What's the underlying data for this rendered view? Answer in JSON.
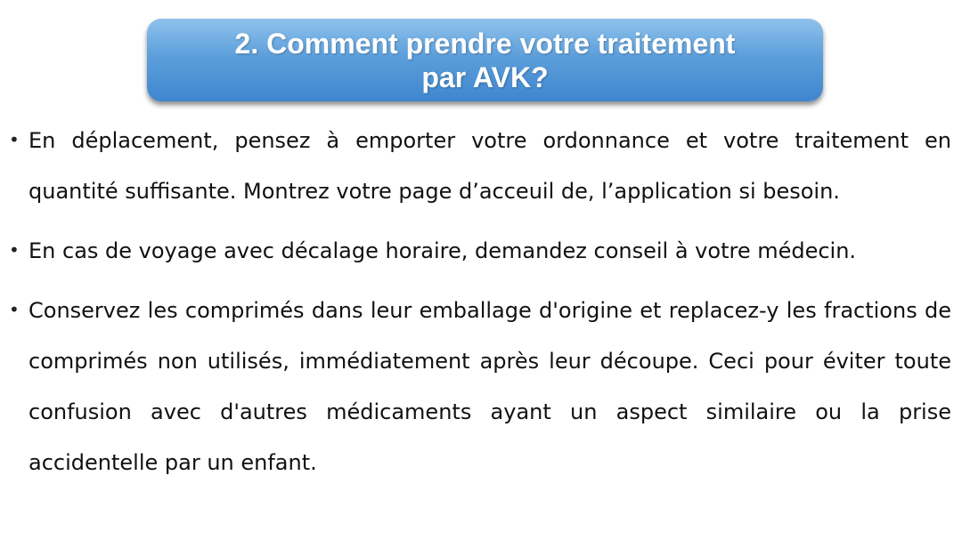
{
  "title": {
    "text": "2. Comment prendre votre traitement\npar AVK?"
  },
  "bullets": [
    {
      "marker": "•",
      "text": "En déplacement, pensez à emporter votre ordonnance et votre traitement en quantité suffisante. Montrez votre page d’acceuil de, l’application si besoin."
    },
    {
      "marker": "•",
      "text": "En cas de voyage avec décalage horaire, demandez conseil à votre médecin."
    },
    {
      "marker": "•",
      "text": "Conservez les comprimés dans leur emballage d'origine et replacez-y les fractions de comprimés non utilisés, immédiatement après leur découpe. Ceci pour éviter toute confusion avec d'autres médicaments ayant un aspect similaire ou la prise accidentelle par un enfant."
    }
  ],
  "colors": {
    "title_bg_top": "#8fc2ec",
    "title_bg_bottom": "#3f86cf",
    "title_text": "#ffffff",
    "body_text": "#111111"
  }
}
